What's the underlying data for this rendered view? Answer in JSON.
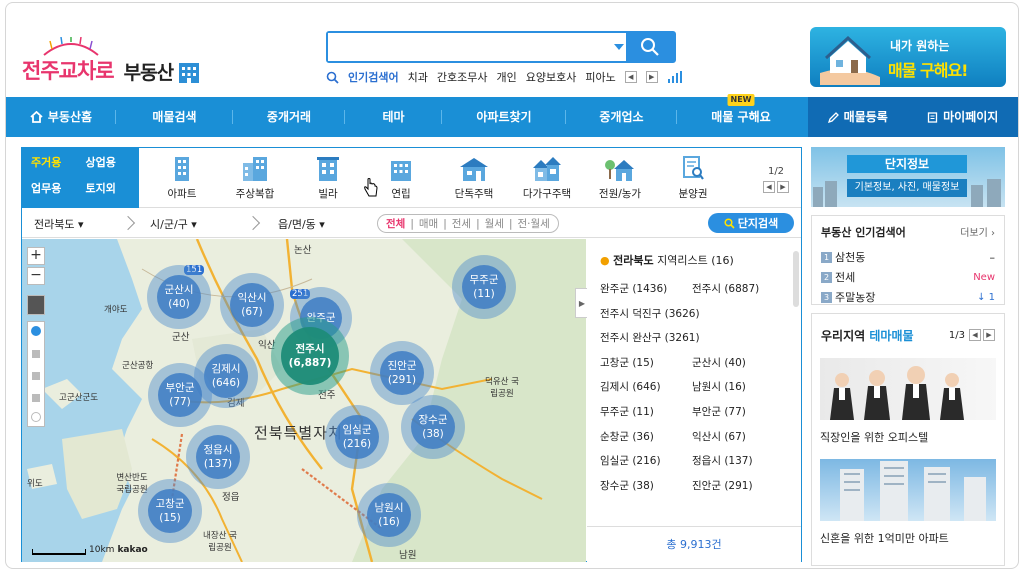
{
  "header": {
    "logo_text": "전주교차로",
    "logo_sub": "부동산",
    "search_value": "",
    "popular_label": "인기검색어",
    "popular_terms": [
      "치과",
      "간호조무사",
      "개인",
      "요양보호사",
      "피아노"
    ],
    "banner_line1": "내가 원하는",
    "banner_line2": "매물 구해요!"
  },
  "nav": {
    "home": "부동산홈",
    "items": [
      "매물검색",
      "중개거래",
      "테마",
      "아파트찾기",
      "중개업소",
      "매물 구해요"
    ],
    "new_badge": "NEW",
    "register": "매물등록",
    "mypage": "마이페이지"
  },
  "categories": {
    "tabs": [
      "주거용",
      "상업용",
      "업무용",
      "토지외"
    ],
    "types": [
      "아파트",
      "주상복합",
      "빌라",
      "연립",
      "단독주택",
      "다가구주택",
      "전원/농가",
      "분양권"
    ],
    "page": "1/2"
  },
  "filters": {
    "province": "전라북도",
    "city": "시/군/구",
    "town": "읍/면/동",
    "deal_types": [
      "전체",
      "매매",
      "전세",
      "월세",
      "전·월세"
    ],
    "complex_search": "단지검색"
  },
  "map": {
    "title": "전북특별자치",
    "clusters": [
      {
        "name": "군산시",
        "count": "(40)"
      },
      {
        "name": "익산시",
        "count": "(67)"
      },
      {
        "name": "완주군",
        "count": ""
      },
      {
        "name": "전주시",
        "count": "(6,887)"
      },
      {
        "name": "김제시",
        "count": "(646)"
      },
      {
        "name": "부안군",
        "count": "(77)"
      },
      {
        "name": "진안군",
        "count": "(291)"
      },
      {
        "name": "무주군",
        "count": "(11)"
      },
      {
        "name": "장수군",
        "count": "(38)"
      },
      {
        "name": "임실군",
        "count": "(216)"
      },
      {
        "name": "정읍시",
        "count": "(137)"
      },
      {
        "name": "고창군",
        "count": "(15)"
      },
      {
        "name": "남원시",
        "count": "(16)"
      }
    ],
    "places": [
      "논산",
      "개야도",
      "군산",
      "익산",
      "군산공항",
      "고군산군도",
      "김제",
      "전주",
      "덕유산 국립공원",
      "변산반도 국립공원",
      "정읍",
      "위도",
      "내장산 국립공원",
      "남원",
      "151",
      "251"
    ],
    "scale": "10km",
    "provider": "kakao"
  },
  "region_list": {
    "province": "전라북도",
    "title": "지역리스트 (16)",
    "items": [
      [
        "완주군 (1436)",
        "전주시 (6887)"
      ],
      [
        "전주시 덕진구 (3626)",
        ""
      ],
      [
        "전주시 완산구 (3261)",
        ""
      ],
      [
        "고창군 (15)",
        "군산시 (40)"
      ],
      [
        "김제시 (646)",
        "남원시 (16)"
      ],
      [
        "무주군 (11)",
        "부안군 (77)"
      ],
      [
        "순창군 (36)",
        "익산시 (67)"
      ],
      [
        "임실군 (216)",
        "정읍시 (137)"
      ],
      [
        "장수군 (38)",
        "진안군 (291)"
      ]
    ],
    "total": "총 9,913건"
  },
  "side": {
    "complex_title": "단지정보",
    "complex_sub": "기본정보, 사진, 매물정보",
    "popular_title": "부동산 인기검색어",
    "more": "더보기 ›",
    "popular": [
      {
        "rank": "1",
        "term": "삼천동",
        "change": "–"
      },
      {
        "rank": "2",
        "term": "전세",
        "change": "New"
      },
      {
        "rank": "3",
        "term": "주말농장",
        "change": "↓ 1"
      }
    ],
    "theme_title_a": "우리지역",
    "theme_title_b": "테마매물",
    "theme_page": "1/3",
    "theme_items": [
      "직장인을 위한 오피스텔",
      "신혼을 위한 1억미만 아파트"
    ]
  }
}
